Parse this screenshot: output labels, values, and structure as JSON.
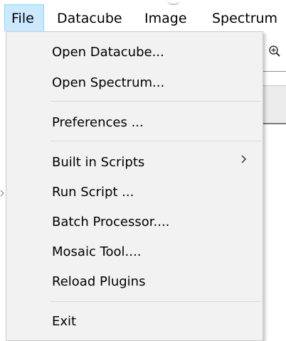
{
  "menubar": {
    "items": [
      {
        "label": "File",
        "active": true
      },
      {
        "label": "Datacube"
      },
      {
        "label": "Image"
      },
      {
        "label": "Spectrum"
      }
    ]
  },
  "file_menu": {
    "items": [
      {
        "label": "Open Datacube..."
      },
      {
        "label": "Open Spectrum..."
      },
      {
        "label": "Preferences ..."
      },
      {
        "label": "Built in Scripts",
        "submenu_icon": "chevron-right-icon"
      },
      {
        "label": "Run Script ..."
      },
      {
        "label": "Batch Processor...."
      },
      {
        "label": "Mosaic Tool...."
      },
      {
        "label": "Reload Plugins"
      },
      {
        "label": "Exit"
      }
    ]
  },
  "background": {
    "toolbar_icon": "zoom-in-icon"
  },
  "colors": {
    "active_menu_bg": "#cce8ff",
    "active_menu_border": "#99d1ff",
    "menu_bg": "#f2f2f2",
    "separator": "#d9d9d9"
  }
}
